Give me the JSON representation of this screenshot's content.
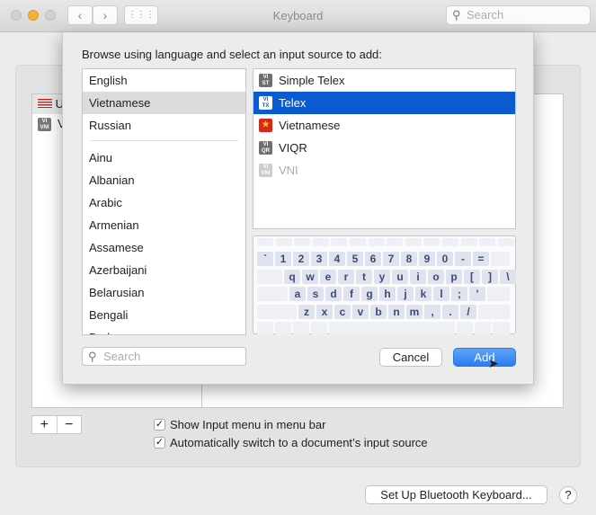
{
  "window": {
    "title": "Keyboard",
    "search_placeholder": "Search"
  },
  "background_list": [
    {
      "label": "U",
      "icon": "us-flag-icon"
    },
    {
      "label": "V",
      "icon": "vi-vni-icon",
      "badge": [
        "VI",
        "VNI"
      ]
    }
  ],
  "sheet": {
    "prompt": "Browse using language and select an input source to add:",
    "languages_top": [
      "English",
      "Vietnamese",
      "Russian"
    ],
    "languages": [
      "Ainu",
      "Albanian",
      "Arabic",
      "Armenian",
      "Assamese",
      "Azerbaijani",
      "Belarusian",
      "Bengali",
      "Bodo"
    ],
    "selected_language": "Vietnamese",
    "sources": [
      {
        "label": "Simple Telex",
        "badge": [
          "VI",
          "ST"
        ],
        "state": "normal"
      },
      {
        "label": "Telex",
        "badge": [
          "VI",
          "TX"
        ],
        "state": "selected"
      },
      {
        "label": "Vietnamese",
        "badge": [
          "★"
        ],
        "state": "normal",
        "icon": "vietnam-flag-icon"
      },
      {
        "label": "VIQR",
        "badge": [
          "VI",
          "QR"
        ],
        "state": "normal"
      },
      {
        "label": "VNI",
        "badge": [
          "VI",
          "VNI"
        ],
        "state": "disabled"
      }
    ],
    "keyboard_rows": [
      [
        "`",
        "1",
        "2",
        "3",
        "4",
        "5",
        "6",
        "7",
        "8",
        "9",
        "0",
        "-",
        "="
      ],
      [
        "q",
        "w",
        "e",
        "r",
        "t",
        "y",
        "u",
        "i",
        "o",
        "p",
        "[",
        "]",
        "\\"
      ],
      [
        "a",
        "s",
        "d",
        "f",
        "g",
        "h",
        "j",
        "k",
        "l",
        ";",
        "'"
      ],
      [
        "z",
        "x",
        "c",
        "v",
        "b",
        "n",
        "m",
        ",",
        ".",
        "/"
      ]
    ],
    "search_placeholder": "Search",
    "cancel_label": "Cancel",
    "add_label": "Add"
  },
  "controls": {
    "plus": "+",
    "minus": "−",
    "show_menu_label": "Show Input menu in menu bar",
    "show_menu_checked": true,
    "auto_switch_label": "Automatically switch to a document’s input source",
    "auto_switch_checked": true,
    "bluetooth_label": "Set Up Bluetooth Keyboard...",
    "help_label": "?"
  },
  "colors": {
    "selection": "#0a5bd2",
    "accent": "#2a7df0"
  }
}
